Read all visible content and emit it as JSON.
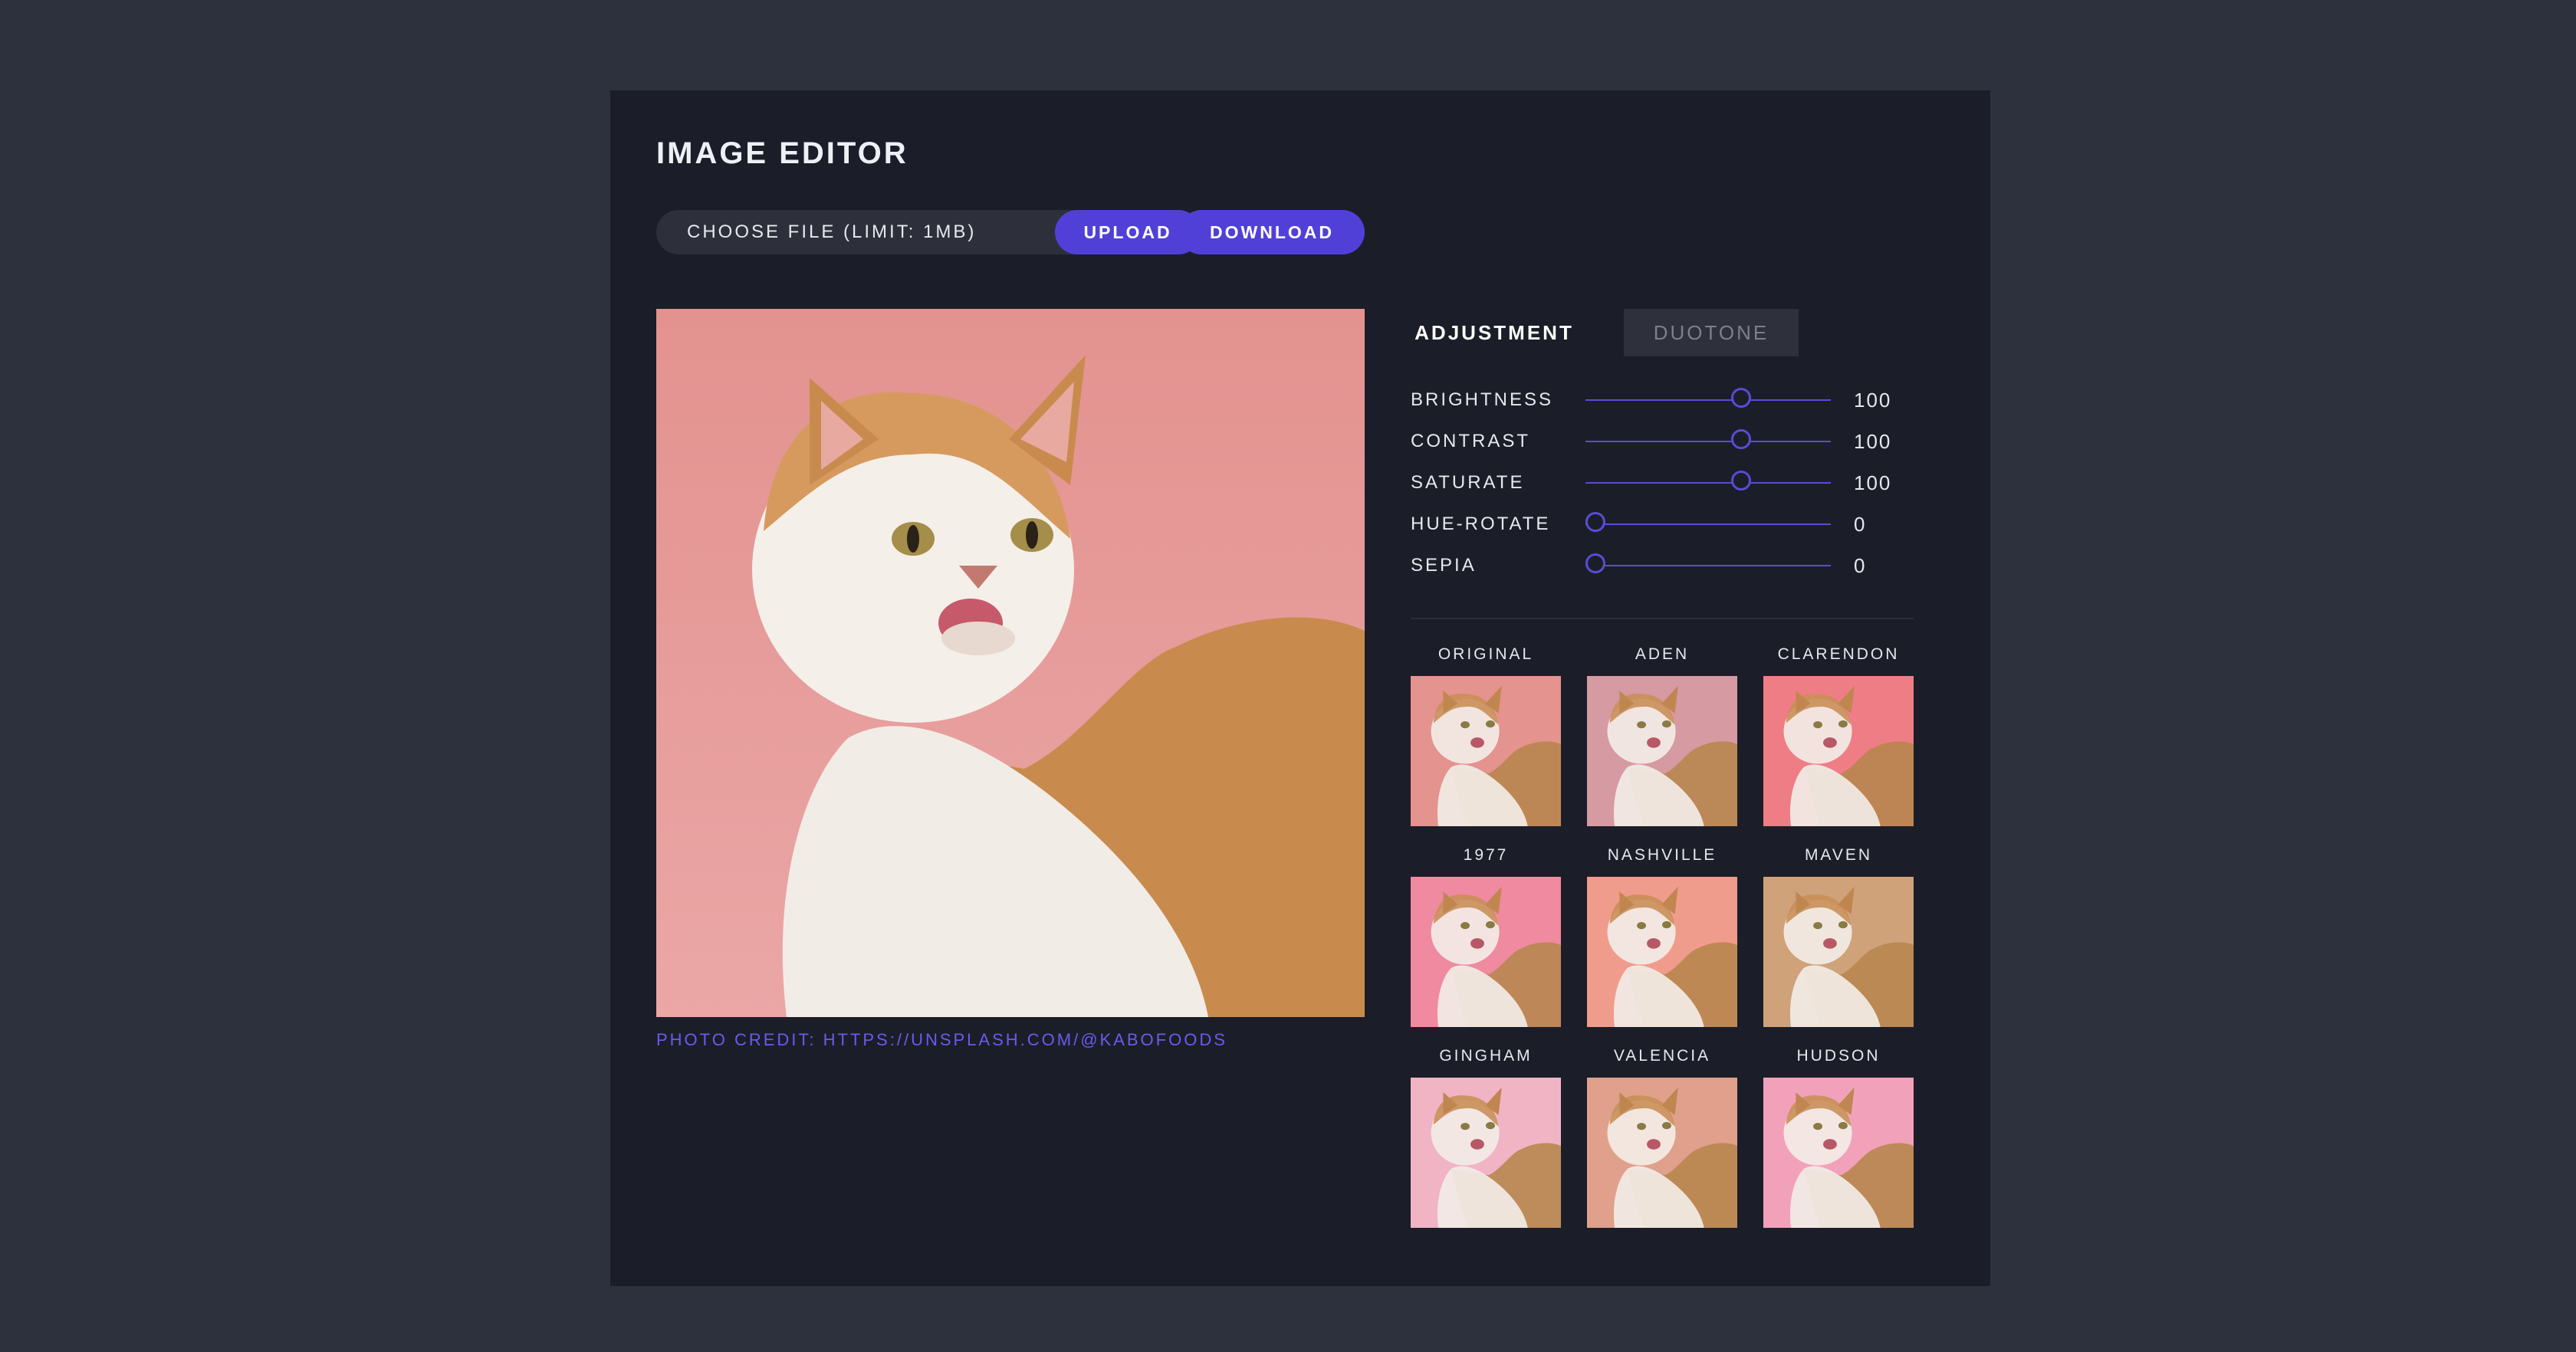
{
  "app": {
    "title": "IMAGE EDITOR"
  },
  "toolbar": {
    "choose_file_label": "CHOOSE FILE (LIMIT: 1MB)",
    "upload_label": "UPLOAD",
    "download_label": "DOWNLOAD"
  },
  "image": {
    "credit": "PHOTO CREDIT: HTTPS://UNSPLASH.COM/@KABOFOODS"
  },
  "tabs": [
    {
      "label": "ADJUSTMENT",
      "active": true
    },
    {
      "label": "DUOTONE",
      "active": false
    }
  ],
  "adjustments": [
    {
      "label": "BRIGHTNESS",
      "value": "100",
      "fraction": 0.645
    },
    {
      "label": "CONTRAST",
      "value": "100",
      "fraction": 0.645
    },
    {
      "label": "SATURATE",
      "value": "100",
      "fraction": 0.645
    },
    {
      "label": "HUE-ROTATE",
      "value": "0",
      "fraction": 0.0
    },
    {
      "label": "SEPIA",
      "value": "0",
      "fraction": 0.0
    }
  ],
  "filters": [
    {
      "name": "ORIGINAL",
      "bg": "#e4938e"
    },
    {
      "name": "ADEN",
      "bg": "#d69aa3"
    },
    {
      "name": "CLARENDON",
      "bg": "#ef7d86"
    },
    {
      "name": "1977",
      "bg": "#f08aa0"
    },
    {
      "name": "NASHVILLE",
      "bg": "#f09c8c"
    },
    {
      "name": "MAVEN",
      "bg": "#cfa27a"
    },
    {
      "name": "GINGHAM",
      "bg": "#f0b4c4"
    },
    {
      "name": "VALENCIA",
      "bg": "#e0a08c"
    },
    {
      "name": "HUDSON",
      "bg": "#f1a2ba"
    }
  ],
  "colors": {
    "accent": "#5140d8",
    "panel": "#1b1e28",
    "background": "#2d313d",
    "photo_bg": "#e59b98"
  }
}
